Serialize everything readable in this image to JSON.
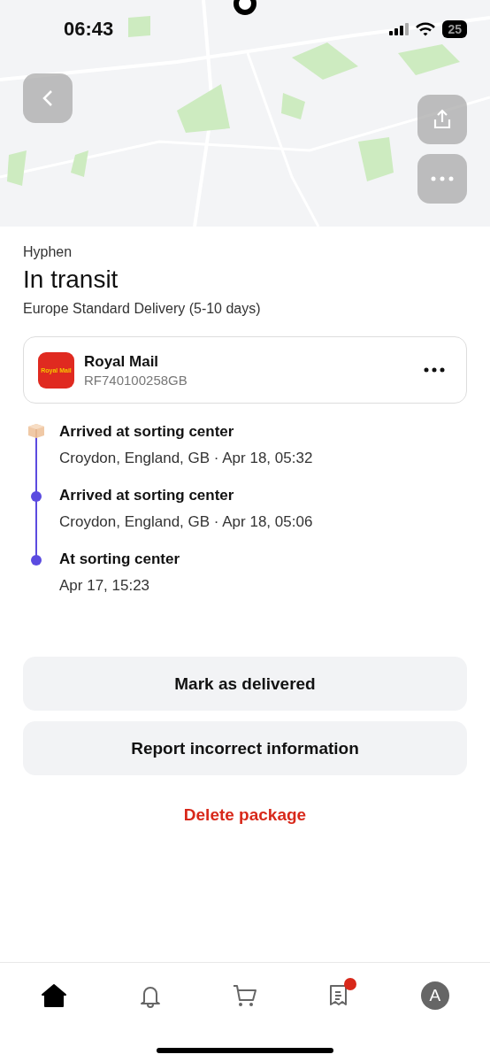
{
  "status_bar": {
    "time": "06:43",
    "battery": "25"
  },
  "package": {
    "store": "Hyphen",
    "status": "In transit",
    "service": "Europe Standard Delivery (5-10 days)"
  },
  "carrier": {
    "logo_text": "Royal Mail",
    "name": "Royal Mail",
    "tracking_number": "RF740100258GB"
  },
  "events": [
    {
      "kind": "package",
      "title": "Arrived at sorting center",
      "detail": "Croydon, England, GB · Apr 18, 05:32"
    },
    {
      "kind": "dot",
      "title": "Arrived at sorting center",
      "detail": "Croydon, England, GB · Apr 18, 05:06"
    },
    {
      "kind": "dot",
      "title": "At sorting center",
      "detail": "Apr 17, 15:23"
    }
  ],
  "actions": [
    "Mark as delivered",
    "Report incorrect information"
  ],
  "delete_label": "Delete package",
  "tab_bar": [
    {
      "kind": "home",
      "selected": true
    },
    {
      "kind": "bell",
      "selected": false
    },
    {
      "kind": "cart",
      "selected": false
    },
    {
      "kind": "receipt",
      "selected": false,
      "badge": true
    },
    {
      "kind": "avatar",
      "selected": false,
      "label": "A"
    }
  ]
}
